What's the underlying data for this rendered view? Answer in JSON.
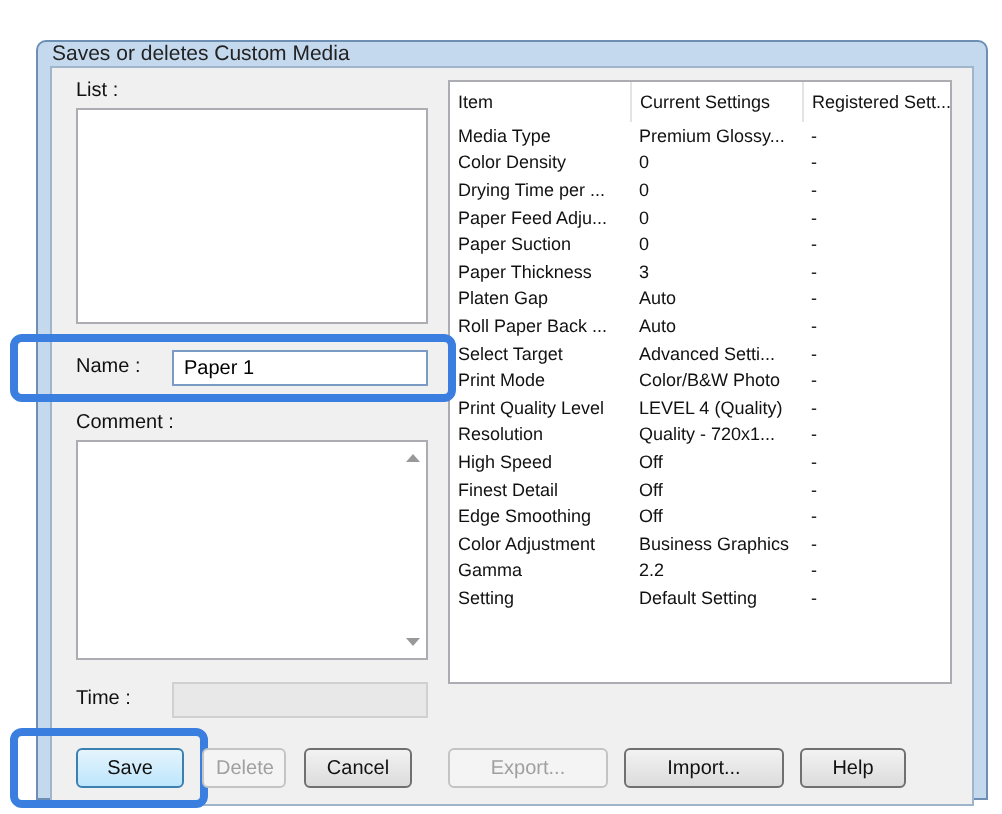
{
  "window": {
    "title": "Saves or deletes Custom Media"
  },
  "list": {
    "label": "List :"
  },
  "name": {
    "label": "Name :",
    "value": "Paper 1",
    "highlighted": true
  },
  "comment": {
    "label": "Comment :"
  },
  "time": {
    "label": "Time :",
    "disabled": true
  },
  "table": {
    "columns": [
      "Item",
      "Current Settings",
      "Registered Sett..."
    ],
    "rows": [
      [
        "Media Type",
        "Premium Glossy...",
        "-"
      ],
      [
        "Color Density",
        "0",
        "-"
      ],
      [
        "Drying Time per ...",
        "0",
        "-"
      ],
      [
        "Paper Feed Adju...",
        "0",
        "-"
      ],
      [
        "Paper Suction",
        "0",
        "-"
      ],
      [
        "Paper Thickness",
        "3",
        "-"
      ],
      [
        "Platen Gap",
        "Auto",
        "-"
      ],
      [
        "Roll Paper Back ...",
        "Auto",
        "-"
      ],
      [
        "Select Target",
        "Advanced Setti...",
        "-"
      ],
      [
        "Print Mode",
        "Color/B&W Photo",
        "-"
      ],
      [
        "Print Quality Level",
        "LEVEL 4 (Quality)",
        "-"
      ],
      [
        "Resolution",
        "Quality - 720x1...",
        "-"
      ],
      [
        "High Speed",
        "Off",
        "-"
      ],
      [
        "Finest Detail",
        "Off",
        "-"
      ],
      [
        "Edge Smoothing",
        "Off",
        "-"
      ],
      [
        "Color Adjustment",
        "Business Graphics",
        "-"
      ],
      [
        "Gamma",
        "2.2",
        "-"
      ],
      [
        "Setting",
        "Default Setting",
        "-"
      ]
    ]
  },
  "left_buttons": [
    {
      "label": "Save",
      "disabled": false,
      "highlighted": true
    },
    {
      "label": "Delete",
      "disabled": true,
      "highlighted": false
    },
    {
      "label": "Cancel",
      "disabled": false,
      "highlighted": false
    }
  ],
  "right_buttons": [
    {
      "label": "Export...",
      "disabled": true,
      "highlighted": false
    },
    {
      "label": "Import...",
      "disabled": false,
      "highlighted": false
    },
    {
      "label": "Help",
      "disabled": false,
      "highlighted": false
    }
  ]
}
